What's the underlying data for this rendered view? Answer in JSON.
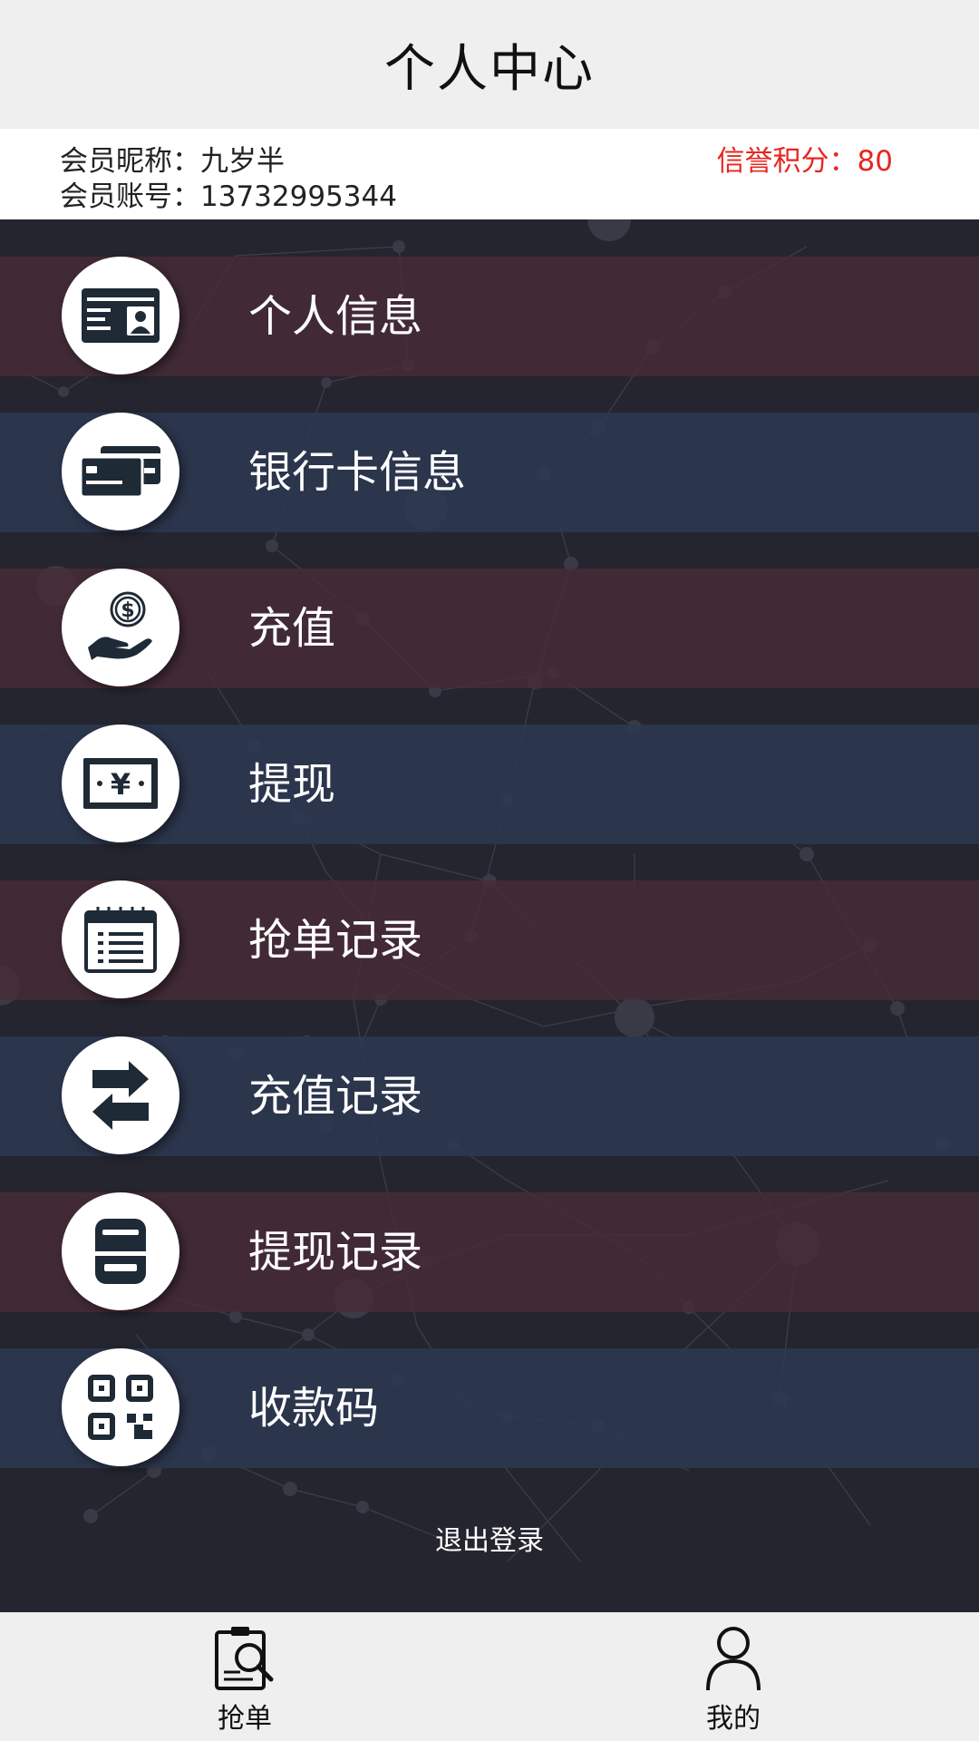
{
  "header": {
    "title": "个人中心"
  },
  "member": {
    "nickname_line": "会员昵称：九岁半",
    "account_line": "会员账号：13732995344",
    "credit_line": "信誉积分：80"
  },
  "menu": {
    "items": [
      {
        "label": "个人信息",
        "icon": "id-card-icon"
      },
      {
        "label": "银行卡信息",
        "icon": "bank-cards-icon"
      },
      {
        "label": "充值",
        "icon": "hand-coin-icon"
      },
      {
        "label": "提现",
        "icon": "yuan-banknote-icon"
      },
      {
        "label": "抢单记录",
        "icon": "calendar-list-icon"
      },
      {
        "label": "充值记录",
        "icon": "exchange-arrows-icon"
      },
      {
        "label": "提现记录",
        "icon": "printer-receipt-icon"
      },
      {
        "label": "收款码",
        "icon": "qr-code-icon"
      }
    ]
  },
  "logout": {
    "label": "退出登录"
  },
  "tabbar": {
    "tabs": [
      {
        "label": "抢单",
        "icon": "clipboard-search-icon"
      },
      {
        "label": "我的",
        "icon": "user-icon"
      }
    ]
  },
  "colors": {
    "credit": "#e8261f",
    "band_red": "#482c38",
    "band_blue": "#2c3850",
    "background": "#24242e"
  }
}
